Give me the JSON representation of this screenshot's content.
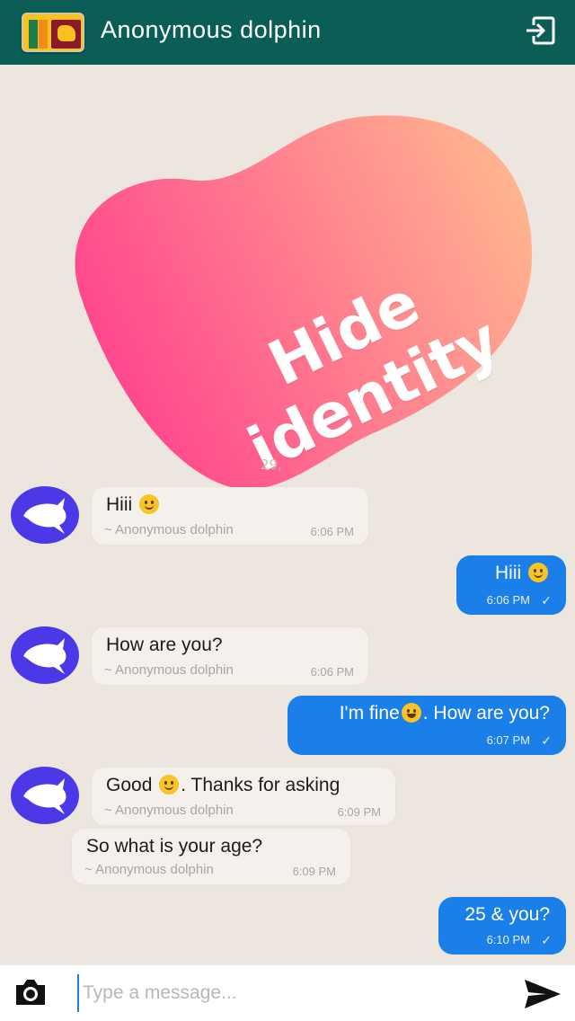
{
  "header": {
    "title": "Anonymous dolphin",
    "flag_icon": "sri-lanka-flag-icon",
    "exit_icon": "exit-icon"
  },
  "promo": {
    "line1": "Hide",
    "line2": "identity",
    "date_stub": "29,"
  },
  "colors": {
    "header": "#0b5e55",
    "background": "#ece6df",
    "outgoing_bubble": "#1a7fe8",
    "incoming_bubble": "#f4f1ed",
    "avatar": "#4b39e8",
    "blob_start": "#ff3f8e",
    "blob_end": "#ffb38f"
  },
  "messages": [
    {
      "dir": "in",
      "text": "Hiii",
      "emoji": "smile",
      "sender": "~ Anonymous dolphin",
      "time": "6:06 PM"
    },
    {
      "dir": "out",
      "text": "Hiii",
      "emoji": "smile",
      "time": "6:06 PM",
      "status": "✓"
    },
    {
      "dir": "in",
      "text": "How are you?",
      "sender": "~ Anonymous dolphin",
      "time": "6:06 PM"
    },
    {
      "dir": "out",
      "text": "I'm fine",
      "text_after": ". How are you?",
      "emoji": "grin",
      "time": "6:07 PM",
      "status": "✓"
    },
    {
      "dir": "in",
      "text": "Good ",
      "text_after": ". Thanks for asking",
      "emoji": "smile",
      "sender": "~ Anonymous dolphin",
      "time": "6:09 PM"
    },
    {
      "dir": "in",
      "text": "So what is your age?",
      "sender": "~ Anonymous dolphin",
      "time": "6:09 PM"
    },
    {
      "dir": "out",
      "text": "25 & you?",
      "time": "6:10 PM",
      "status": "✓"
    }
  ],
  "input": {
    "placeholder": "Type a message...",
    "camera_icon": "camera-icon",
    "send_icon": "send-icon"
  }
}
